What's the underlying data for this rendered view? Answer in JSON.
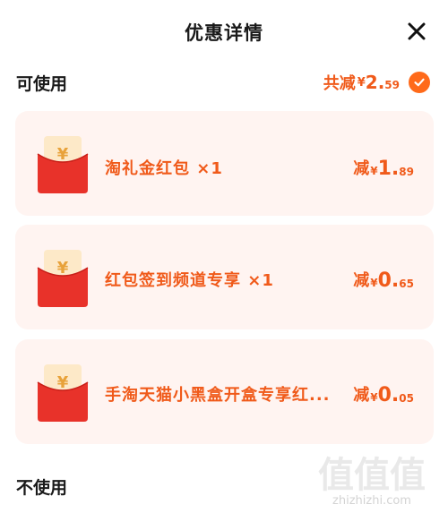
{
  "header": {
    "title": "优惠详情"
  },
  "available": {
    "label": "可使用",
    "total_prefix": "共减",
    "total_currency": "¥",
    "total_int": "2.",
    "total_dec": "59",
    "checked": true
  },
  "coupons": [
    {
      "name": "淘礼金红包 ×1",
      "prefix": "减",
      "currency": "¥",
      "int": "1.",
      "dec": "89"
    },
    {
      "name": "红包签到频道专享 ×1",
      "prefix": "减",
      "currency": "¥",
      "int": "0.",
      "dec": "65"
    },
    {
      "name": "手淘天猫小黑盒开盒专享红...",
      "prefix": "减",
      "currency": "¥",
      "int": "0.",
      "dec": "05"
    }
  ],
  "unavailable": {
    "label": "不使用"
  },
  "watermark": {
    "text": "zhizhizhi.com",
    "logo": "值值值"
  },
  "colors": {
    "accent": "#f05a1a",
    "card_bg": "#fff4f1",
    "envelope": "#e8322a"
  }
}
